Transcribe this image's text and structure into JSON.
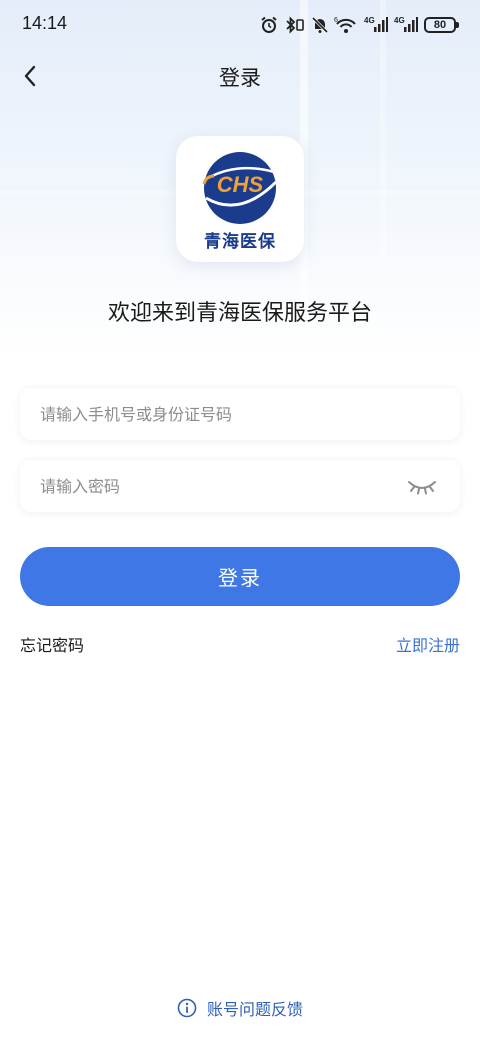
{
  "status_bar": {
    "time": "14:14",
    "network_1": "4G",
    "network_2": "4G",
    "battery": "80",
    "wifi_badge": "6"
  },
  "nav": {
    "title": "登录"
  },
  "logo": {
    "emblem_text": "CHS",
    "caption": "青海医保"
  },
  "welcome": "欢迎来到青海医保服务平台",
  "form": {
    "account_placeholder": "请输入手机号或身份证号码",
    "account_value": "",
    "password_placeholder": "请输入密码",
    "password_value": "",
    "login_label": "登录"
  },
  "links": {
    "forgot_password": "忘记密码",
    "register": "立即注册"
  },
  "footer": {
    "feedback": "账号问题反馈"
  },
  "colors": {
    "primary": "#3f78e6",
    "link": "#3a72d8",
    "logo_blue": "#1b3c8c",
    "logo_orange": "#f0a23a"
  }
}
